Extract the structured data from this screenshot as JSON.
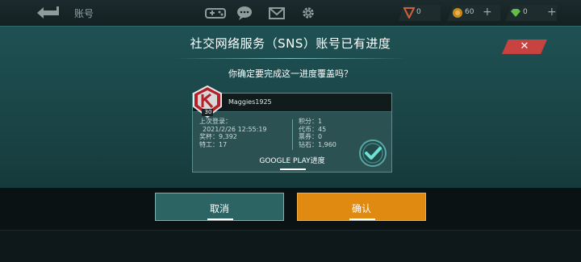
{
  "topbar": {
    "title": "账号",
    "currencies": [
      {
        "icon": "rank-shield-icon",
        "value": "0"
      },
      {
        "icon": "gold-coin-icon",
        "value": "60"
      },
      {
        "icon": "diamond-icon",
        "value": "0"
      }
    ],
    "plus": "+"
  },
  "dialog": {
    "title": "社交网络服务（SNS）账号已有进度",
    "question": "你确定要完成这一进度覆盖吗？",
    "close": "✕",
    "card": {
      "username": "Maggies1925",
      "level": "30",
      "last_login_label": "上次登录：",
      "last_login": "2021/2/26 12:55:19",
      "trophies": "奖杯：9,392",
      "agents": "特工：17",
      "points": "积分：1",
      "tokens": "代币：45",
      "tickets": "票券：0",
      "diamonds": "钻石：1,960",
      "source": "GOOGLE PLAY进度"
    },
    "cancel": "取消",
    "confirm": "确认"
  },
  "colors": {
    "accent": "#e08a12",
    "teal": "#1f5153",
    "close_red": "#c8423f",
    "badge_red": "#b3202a"
  }
}
